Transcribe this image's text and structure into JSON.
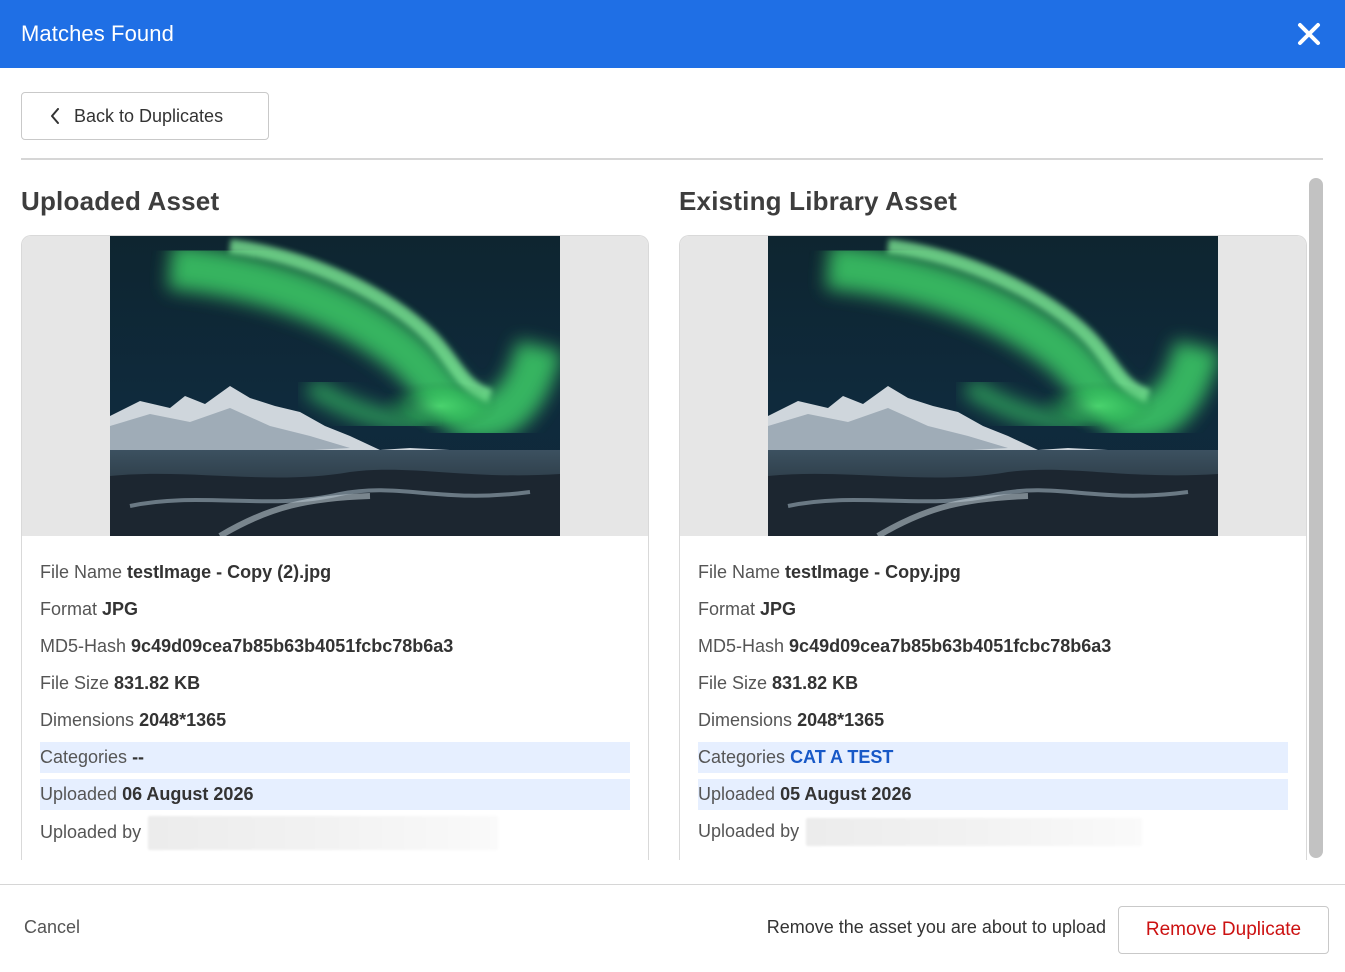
{
  "header": {
    "title": "Matches Found",
    "close_icon": "close-icon"
  },
  "toolbar": {
    "back_label": "Back to Duplicates",
    "back_icon": "chevron-left-icon"
  },
  "uploaded": {
    "heading": "Uploaded Asset",
    "file_name_label": "File Name",
    "file_name": "testImage - Copy (2).jpg",
    "format_label": "Format",
    "format": "JPG",
    "md5_label": "MD5-Hash",
    "md5": "9c49d09cea7b85b63b4051fcbc78b6a3",
    "size_label": "File Size",
    "size": "831.82 KB",
    "dimensions_label": "Dimensions",
    "dimensions": "2048*1365",
    "categories_label": "Categories",
    "categories": "--",
    "uploaded_label": "Uploaded",
    "uploaded": "06 August 2026",
    "uploaded_by_label": "Uploaded by"
  },
  "existing": {
    "heading": "Existing Library Asset",
    "file_name_label": "File Name",
    "file_name": "testImage - Copy.jpg",
    "format_label": "Format",
    "format": "JPG",
    "md5_label": "MD5-Hash",
    "md5": "9c49d09cea7b85b63b4051fcbc78b6a3",
    "size_label": "File Size",
    "size": "831.82 KB",
    "dimensions_label": "Dimensions",
    "dimensions": "2048*1365",
    "categories_label": "Categories",
    "categories": "CAT A TEST",
    "uploaded_label": "Uploaded",
    "uploaded": "05 August 2026",
    "uploaded_by_label": "Uploaded by"
  },
  "footer": {
    "cancel_label": "Cancel",
    "hint": "Remove the asset you are about to upload",
    "remove_label": "Remove Duplicate"
  },
  "colors": {
    "header_bg": "#1f6fe5",
    "highlight_row": "#e6efff",
    "danger": "#cc1111",
    "link": "#1758c7"
  }
}
